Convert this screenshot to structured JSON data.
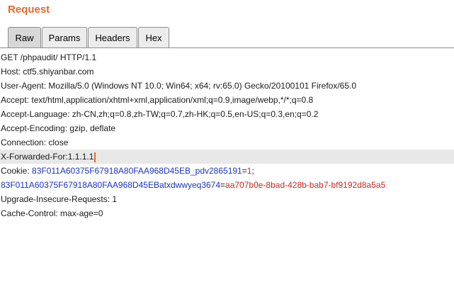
{
  "panel": {
    "title": "Request"
  },
  "tabs": [
    "Raw",
    "Params",
    "Headers",
    "Hex"
  ],
  "active_tab": "Raw",
  "request": {
    "request_line": "GET /phpaudit/ HTTP/1.1",
    "host": "Host: ctf5.shiyanbar.com",
    "user_agent": "User-Agent: Mozilla/5.0 (Windows NT 10.0; Win64; x64; rv:65.0) Gecko/20100101 Firefox/65.0",
    "accept": "Accept: text/html,application/xhtml+xml,application/xml;q=0.9,image/webp,*/*;q=0.8",
    "accept_language": "Accept-Language: zh-CN,zh;q=0.8,zh-TW;q=0.7,zh-HK;q=0.5,en-US;q=0.3,en;q=0.2",
    "accept_encoding": "Accept-Encoding: gzip, deflate",
    "connection": "Connection: close",
    "x_forwarded_for": "X-Forwarded-For:1.1.1.1",
    "cookie_label": "Cookie: ",
    "cookie1_name": "83F011A60375F67918A80FAA968D45EB_pdv2865191",
    "cookie1_eq": "=",
    "cookie1_value": "1",
    "cookie1_sep": ";",
    "cookie2_name": "83F011A60375F67918A80FAA968D45EBatxdwwyeq3674",
    "cookie2_eq": "=",
    "cookie2_value": "aa707b0e-8bad-428b-bab7-bf9192d8a5a5",
    "upgrade_insecure": "Upgrade-Insecure-Requests: 1",
    "cache_control": "Cache-Control: max-age=0"
  },
  "colors": {
    "title": "#e8672a",
    "param_name": "#1b33c4",
    "param_value": "#c8291f",
    "caret": "#e8672a",
    "current_line": "#e8e8e8"
  }
}
